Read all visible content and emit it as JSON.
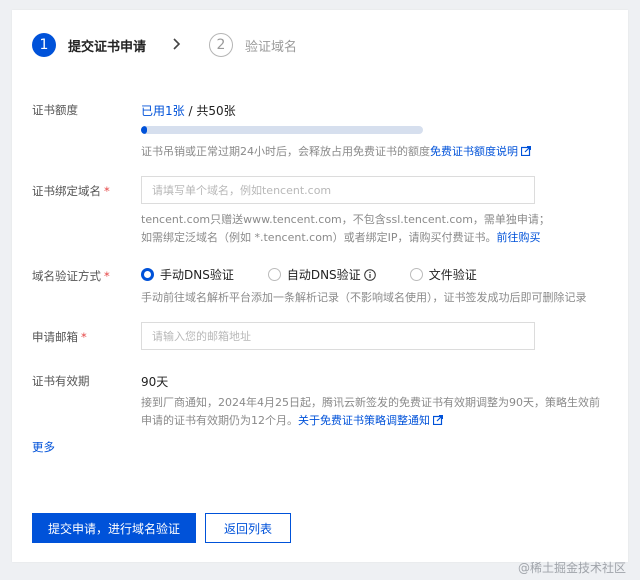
{
  "steps": [
    {
      "number": "1",
      "label": "提交证书申请"
    },
    {
      "number": "2",
      "label": "验证域名"
    }
  ],
  "quota": {
    "label": "证书额度",
    "used_text": "已用1张",
    "separator": " / ",
    "total_text": "共50张",
    "used": 1,
    "total": 50,
    "help_text": "证书吊销或正常过期24小时后，会释放占用免费证书的额度",
    "help_link": "免费证书额度说明"
  },
  "domain": {
    "label": "证书绑定域名",
    "placeholder": "请填写单个域名，例如tencent.com",
    "help_line1": "tencent.com只赠送www.tencent.com，不包含ssl.tencent.com，需单独申请；",
    "help_line2": "如需绑定泛域名（例如 *.tencent.com）或者绑定IP，请购买付费证书。",
    "help_link": "前往购买"
  },
  "verification": {
    "label": "域名验证方式",
    "options": [
      "手动DNS验证",
      "自动DNS验证",
      "文件验证"
    ],
    "selected": "手动DNS验证",
    "help_text": "手动前往域名解析平台添加一条解析记录（不影响域名使用），证书签发成功后即可删除记录"
  },
  "email": {
    "label": "申请邮箱",
    "placeholder": "请输入您的邮箱地址"
  },
  "validity": {
    "label": "证书有效期",
    "value": "90天",
    "notice_line1": "接到厂商通知，2024年4月25日起，腾讯云新签发的免费证书有效期调整为90天，策略生效前",
    "notice_line2": "申请的证书有效期仍为12个月。",
    "notice_link": "关于免费证书策略调整通知"
  },
  "more_label": "更多",
  "actions": {
    "submit_label": "提交申请，进行域名验证",
    "back_label": "返回列表"
  },
  "watermark": "@稀土掘金技术社区",
  "colors": {
    "primary": "#0052d9",
    "required": "#e54545",
    "help_text": "#8a8a8a"
  },
  "icons": {
    "step_separator": "chevron-right-icon",
    "external_link": "external-link-icon",
    "info": "info-circle-icon"
  }
}
